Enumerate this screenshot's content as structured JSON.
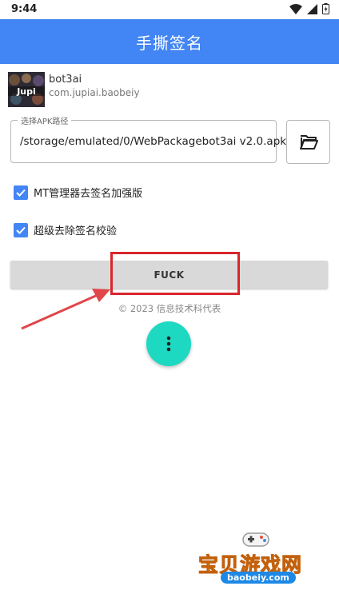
{
  "status_bar": {
    "time": "9:44"
  },
  "app_bar": {
    "title": "手撕签名"
  },
  "app_info": {
    "icon_text": "Jupi",
    "name": "bot3ai",
    "package": "com.jupiai.baobeiy"
  },
  "apk_path": {
    "label": "选择APK路径",
    "value": "/storage/emulated/0/WebPackagebot3ai v2.0.apk"
  },
  "options": [
    {
      "label": "MT管理器去签名加强版",
      "checked": true
    },
    {
      "label": "超级去除签名校验",
      "checked": true
    }
  ],
  "main_button": {
    "label": "FUCK"
  },
  "copyright": "© 2023 信息技术科代表",
  "watermark": {
    "logo": "宝贝游戏网",
    "url": "baobeiy.com"
  },
  "colors": {
    "app_bar": "#4285f4",
    "checkbox": "#4285f4",
    "fab": "#1dd9c1",
    "highlight": "#d9262c"
  },
  "icons": {
    "folder": "folder-open-icon",
    "fab": "more-vert-icon"
  }
}
